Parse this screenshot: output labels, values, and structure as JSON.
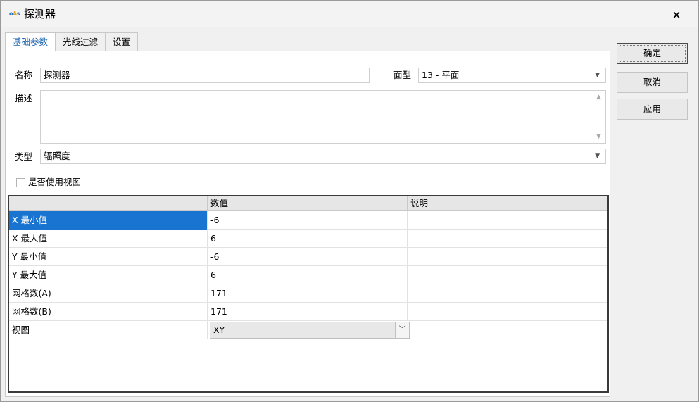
{
  "window": {
    "title": "探测器",
    "app_icon": "oAs",
    "close_label": "×"
  },
  "tabs": [
    {
      "label": "基础参数",
      "active": true
    },
    {
      "label": "光线过滤",
      "active": false
    },
    {
      "label": "设置",
      "active": false
    }
  ],
  "form": {
    "name_label": "名称",
    "name_value": "探测器",
    "surface_label": "面型",
    "surface_value": "13 - 平面",
    "desc_label": "描述",
    "desc_value": "",
    "type_label": "类型",
    "type_value": "辐照度",
    "use_view_label": "是否使用视图",
    "use_view_checked": false
  },
  "grid": {
    "columns": [
      "",
      "数值",
      "说明"
    ],
    "rows": [
      {
        "name": "X 最小值",
        "value": "-6",
        "note": ""
      },
      {
        "name": "X 最大值",
        "value": "6",
        "note": ""
      },
      {
        "name": "Y 最小值",
        "value": "-6",
        "note": ""
      },
      {
        "name": "Y 最大值",
        "value": "6",
        "note": ""
      },
      {
        "name": "网格数(A)",
        "value": "171",
        "note": ""
      },
      {
        "name": "网格数(B)",
        "value": "171",
        "note": ""
      },
      {
        "name": "视图",
        "value": "XY",
        "note": ""
      }
    ],
    "selected_row": 0
  },
  "buttons": {
    "ok": "确定",
    "cancel": "取消",
    "apply": "应用"
  },
  "icons": {
    "close": "close-icon",
    "dropdown": "chevron-down-icon",
    "scroll_up": "scroll-up-icon",
    "scroll_down": "scroll-down-icon"
  }
}
